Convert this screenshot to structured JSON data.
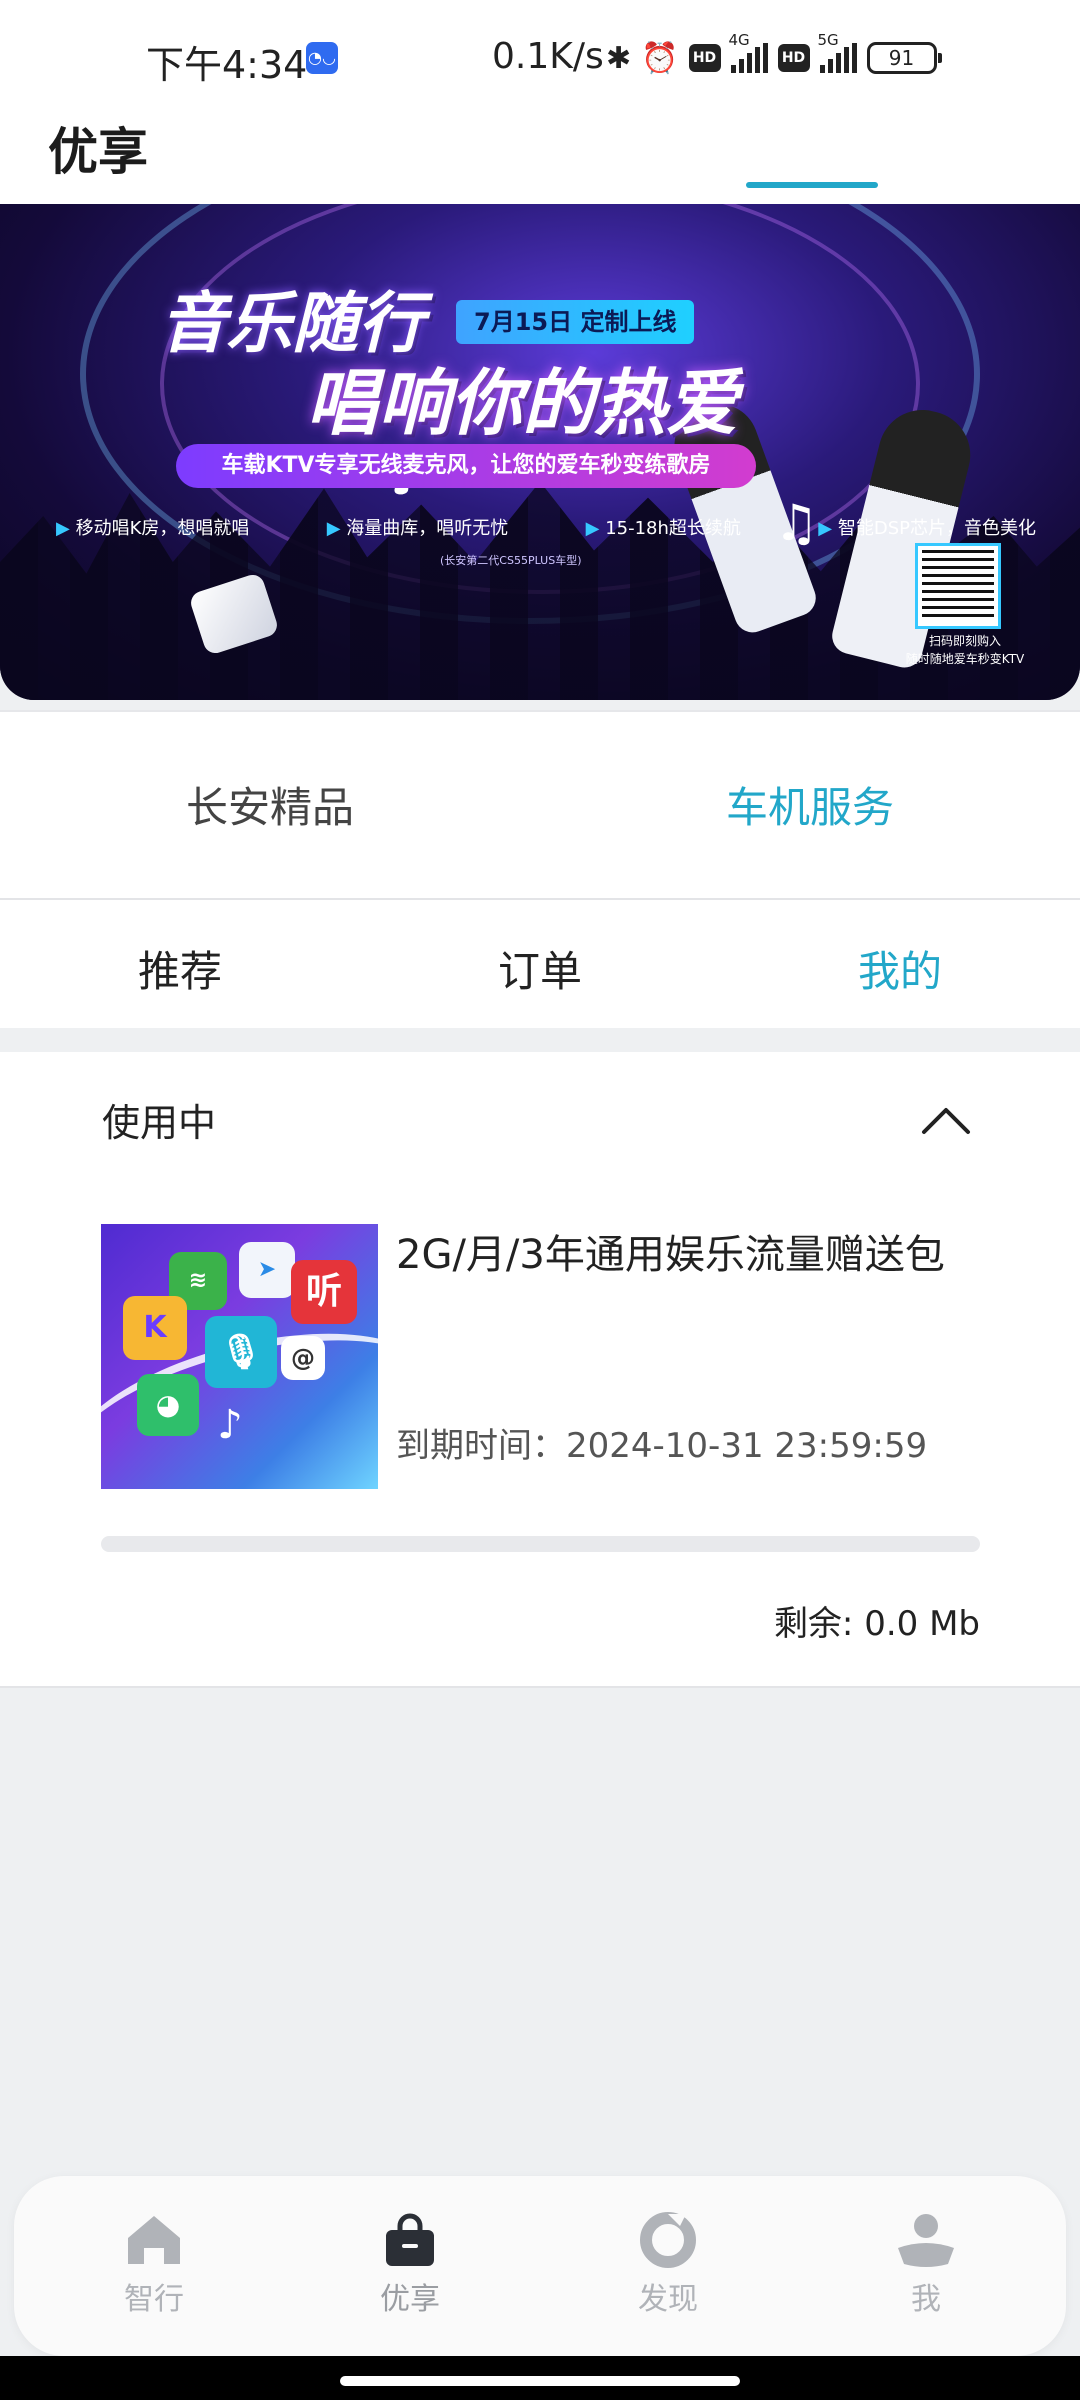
{
  "status_bar": {
    "time": "下午4:34",
    "app_icon_glyph": "◔◡",
    "net_speed": "0.1K/s",
    "bluetooth_icon": "bluetooth-icon",
    "alarm_icon": "alarm-icon",
    "hd1": "HD",
    "sig1_tag": "4G",
    "hd2": "HD",
    "sig2_tag": "5G",
    "battery": "91"
  },
  "header": {
    "title": "优享"
  },
  "banner": {
    "title_line1": "音乐随行",
    "title_line2": "唱响你的热爱",
    "date_badge": "7月15日  定制上线",
    "slogan": "车载KTV专享无线麦克风，让您的爱车秒变练歌房",
    "features": [
      "移动唱K房，想唱就唱",
      "海量曲库，唱听无忧",
      "15-18h超长续航",
      "智能DSP芯片，音色美化"
    ],
    "note": "(长安第二代CS55PLUS车型)",
    "qr_text_line1": "扫码即刻购入",
    "qr_text_line2": "随时随地爱车秒变KTV"
  },
  "main_tabs": [
    {
      "label": "长安精品",
      "active": false
    },
    {
      "label": "车机服务",
      "active": true
    }
  ],
  "sub_tabs": [
    {
      "label": "推荐",
      "active": false
    },
    {
      "label": "订单",
      "active": false
    },
    {
      "label": "我的",
      "active": true
    }
  ],
  "in_use": {
    "section_title": "使用中",
    "item": {
      "name": "2G/月/3年通用娱乐流量赠送包",
      "expiry_label": "到期时间：",
      "expiry_value": "2024-10-31 23:59:59",
      "remaining_label": "剩余: 0.0 Mb",
      "progress_fraction": 0.0,
      "thumb_tile_label": "听"
    }
  },
  "bottom_nav": [
    {
      "label": "智行",
      "icon": "home-icon",
      "active": false
    },
    {
      "label": "优享",
      "icon": "bag-icon",
      "active": true
    },
    {
      "label": "发现",
      "icon": "discover-icon",
      "active": false
    },
    {
      "label": "我",
      "icon": "person-icon",
      "active": false
    }
  ],
  "colors": {
    "accent": "#22a7c9",
    "background": "#eef0f2",
    "nav_inactive": "#b0b3b8",
    "nav_active_icon": "#2b2f36"
  }
}
